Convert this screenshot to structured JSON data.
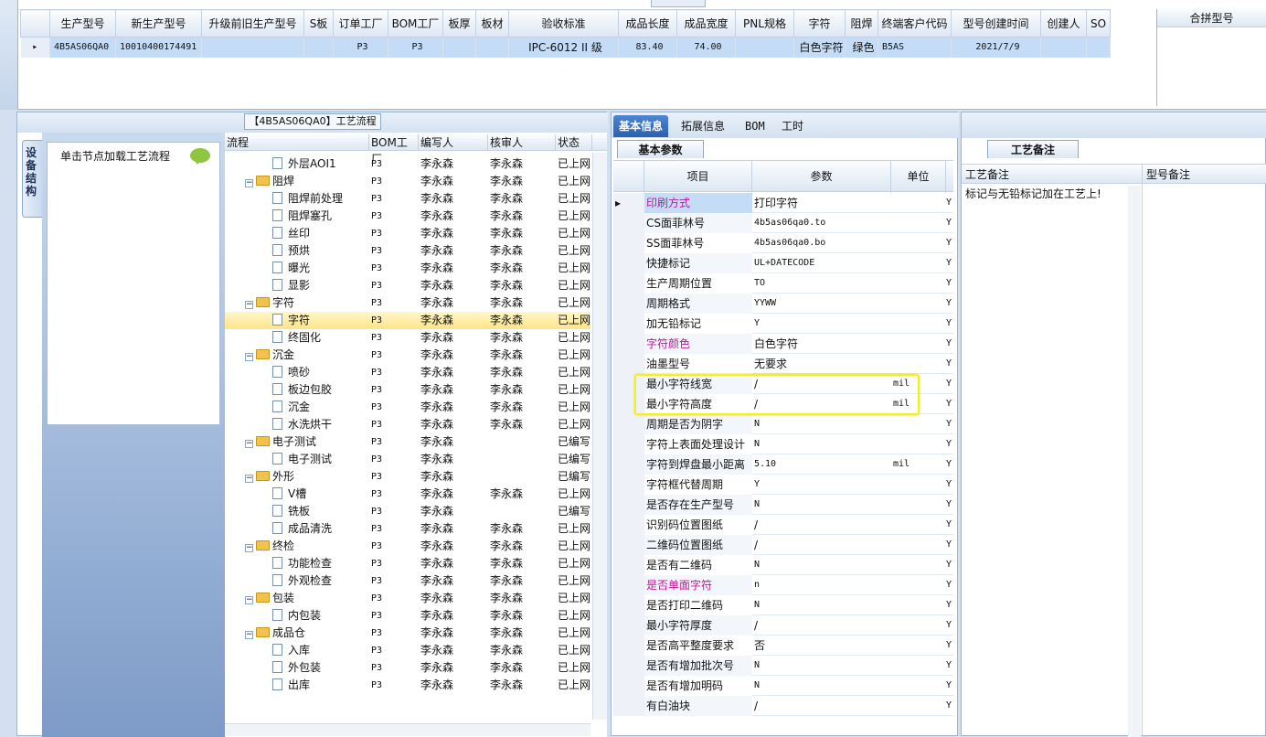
{
  "top_grid": {
    "headers": [
      "生产型号",
      "新生产型号",
      "升级前旧生产型号",
      "S板",
      "订单工厂",
      "BOM工厂",
      "板厚",
      "板材",
      "验收标准",
      "成品长度",
      "成品宽度",
      "PNL规格",
      "字符",
      "阻焊",
      "终端客户代码",
      "型号创建时间",
      "创建人",
      "SO"
    ],
    "row": [
      "4B5AS06QA0",
      "10010400174491",
      "",
      "",
      "P3",
      "P3",
      "",
      "",
      "IPC-6012 II 级",
      "83.40",
      "74.00",
      "",
      "白色字符",
      "绿色",
      "B5AS",
      "2021/7/9",
      "",
      ""
    ],
    "merge_header": "合拼型号"
  },
  "left": {
    "title": "【4B5AS06QA0】工艺流程",
    "vertical_tab": "设备结构",
    "node_hint": "单击节点加载工艺流程",
    "tree_headers": [
      "流程",
      "BOM工厂",
      "编写人",
      "核审人",
      "状态"
    ],
    "tree_rows": [
      {
        "name": "外层AOI1",
        "level": 2,
        "bom": "P3",
        "writer": "李永森",
        "reviewer": "李永森",
        "status": "已上网"
      },
      {
        "name": "阻焊",
        "level": 1,
        "bom": "P3",
        "writer": "李永森",
        "reviewer": "李永森",
        "status": "已上网"
      },
      {
        "name": "阻焊前处理",
        "level": 2,
        "bom": "P3",
        "writer": "李永森",
        "reviewer": "李永森",
        "status": "已上网"
      },
      {
        "name": "阻焊塞孔",
        "level": 2,
        "bom": "P3",
        "writer": "李永森",
        "reviewer": "李永森",
        "status": "已上网"
      },
      {
        "name": "丝印",
        "level": 2,
        "bom": "P3",
        "writer": "李永森",
        "reviewer": "李永森",
        "status": "已上网"
      },
      {
        "name": "预烘",
        "level": 2,
        "bom": "P3",
        "writer": "李永森",
        "reviewer": "李永森",
        "status": "已上网"
      },
      {
        "name": "曝光",
        "level": 2,
        "bom": "P3",
        "writer": "李永森",
        "reviewer": "李永森",
        "status": "已上网"
      },
      {
        "name": "显影",
        "level": 2,
        "bom": "P3",
        "writer": "李永森",
        "reviewer": "李永森",
        "status": "已上网"
      },
      {
        "name": "字符",
        "level": 1,
        "bom": "P3",
        "writer": "李永森",
        "reviewer": "李永森",
        "status": "已上网"
      },
      {
        "name": "字符",
        "level": 2,
        "bom": "P3",
        "writer": "李永森",
        "reviewer": "李永森",
        "status": "已上网",
        "selected": true
      },
      {
        "name": "终固化",
        "level": 2,
        "bom": "P3",
        "writer": "李永森",
        "reviewer": "李永森",
        "status": "已上网"
      },
      {
        "name": "沉金",
        "level": 1,
        "bom": "P3",
        "writer": "李永森",
        "reviewer": "李永森",
        "status": "已上网"
      },
      {
        "name": "喷砂",
        "level": 2,
        "bom": "P3",
        "writer": "李永森",
        "reviewer": "李永森",
        "status": "已上网"
      },
      {
        "name": "板边包胶",
        "level": 2,
        "bom": "P3",
        "writer": "李永森",
        "reviewer": "李永森",
        "status": "已上网"
      },
      {
        "name": "沉金",
        "level": 2,
        "bom": "P3",
        "writer": "李永森",
        "reviewer": "李永森",
        "status": "已上网"
      },
      {
        "name": "水洗烘干",
        "level": 2,
        "bom": "P3",
        "writer": "李永森",
        "reviewer": "李永森",
        "status": "已上网"
      },
      {
        "name": "电子测试",
        "level": 1,
        "bom": "P3",
        "writer": "李永森",
        "reviewer": "",
        "status": "已编写"
      },
      {
        "name": "电子测试",
        "level": 2,
        "bom": "P3",
        "writer": "李永森",
        "reviewer": "",
        "status": "已编写"
      },
      {
        "name": "外形",
        "level": 1,
        "bom": "P3",
        "writer": "李永森",
        "reviewer": "",
        "status": "已编写"
      },
      {
        "name": "V槽",
        "level": 2,
        "bom": "P3",
        "writer": "李永森",
        "reviewer": "李永森",
        "status": "已上网"
      },
      {
        "name": "铣板",
        "level": 2,
        "bom": "P3",
        "writer": "李永森",
        "reviewer": "",
        "status": "已编写"
      },
      {
        "name": "成品清洗",
        "level": 2,
        "bom": "P3",
        "writer": "李永森",
        "reviewer": "李永森",
        "status": "已上网"
      },
      {
        "name": "终检",
        "level": 1,
        "bom": "P3",
        "writer": "李永森",
        "reviewer": "李永森",
        "status": "已上网"
      },
      {
        "name": "功能检查",
        "level": 2,
        "bom": "P3",
        "writer": "李永森",
        "reviewer": "李永森",
        "status": "已上网"
      },
      {
        "name": "外观检查",
        "level": 2,
        "bom": "P3",
        "writer": "李永森",
        "reviewer": "李永森",
        "status": "已上网"
      },
      {
        "name": "包装",
        "level": 1,
        "bom": "P3",
        "writer": "李永森",
        "reviewer": "李永森",
        "status": "已上网"
      },
      {
        "name": "内包装",
        "level": 2,
        "bom": "P3",
        "writer": "李永森",
        "reviewer": "李永森",
        "status": "已上网"
      },
      {
        "name": "成品仓",
        "level": 1,
        "bom": "P3",
        "writer": "李永森",
        "reviewer": "李永森",
        "status": "已上网"
      },
      {
        "name": "入库",
        "level": 2,
        "bom": "P3",
        "writer": "李永森",
        "reviewer": "李永森",
        "status": "已上网"
      },
      {
        "name": "外包装",
        "level": 2,
        "bom": "P3",
        "writer": "李永森",
        "reviewer": "李永森",
        "status": "已上网"
      },
      {
        "name": "出库",
        "level": 2,
        "bom": "P3",
        "writer": "李永森",
        "reviewer": "李永森",
        "status": "已上网"
      }
    ]
  },
  "middle": {
    "tabs": [
      "基本信息",
      "拓展信息",
      "BOM",
      "工时"
    ],
    "sub_tab": "基本参数",
    "headers": [
      "项目",
      "参数",
      "单位"
    ],
    "rows": [
      {
        "item": "印刷方式",
        "param": "打印字符",
        "unit": "",
        "flag": "Y",
        "magenta": true,
        "current": true
      },
      {
        "item": "CS面菲林号",
        "param": "4b5as06qa0.to",
        "unit": "",
        "flag": "Y",
        "mono": true
      },
      {
        "item": "SS面菲林号",
        "param": "4b5as06qa0.bo",
        "unit": "",
        "flag": "Y",
        "mono": true
      },
      {
        "item": "快捷标记",
        "param": "UL+DATECODE",
        "unit": "",
        "flag": "Y",
        "mono": true
      },
      {
        "item": "生产周期位置",
        "param": "TO",
        "unit": "",
        "flag": "Y",
        "mono": true
      },
      {
        "item": "周期格式",
        "param": "YYWW",
        "unit": "",
        "flag": "Y",
        "mono": true
      },
      {
        "item": "加无铅标记",
        "param": "Y",
        "unit": "",
        "flag": "Y",
        "mono": true
      },
      {
        "item": "字符颜色",
        "param": "白色字符",
        "unit": "",
        "flag": "Y",
        "magenta": true
      },
      {
        "item": "油墨型号",
        "param": "无要求",
        "unit": "",
        "flag": "Y"
      },
      {
        "item": "最小字符线宽",
        "param": "/",
        "unit": "mil",
        "flag": "Y"
      },
      {
        "item": "最小字符高度",
        "param": "/",
        "unit": "mil",
        "flag": "Y"
      },
      {
        "item": "周期是否为阴字",
        "param": "N",
        "unit": "",
        "flag": "Y",
        "mono": true
      },
      {
        "item": "字符上表面处理设计",
        "param": "N",
        "unit": "",
        "flag": "Y",
        "mono": true
      },
      {
        "item": "字符到焊盘最小距离",
        "param": "5.10",
        "unit": "mil",
        "flag": "Y",
        "mono": true
      },
      {
        "item": "字符框代替周期",
        "param": "Y",
        "unit": "",
        "flag": "Y",
        "mono": true
      },
      {
        "item": "是否存在生产型号",
        "param": "N",
        "unit": "",
        "flag": "Y",
        "mono": true
      },
      {
        "item": "识别码位置图纸",
        "param": "/",
        "unit": "",
        "flag": "Y"
      },
      {
        "item": "二维码位置图纸",
        "param": "/",
        "unit": "",
        "flag": "Y"
      },
      {
        "item": "是否有二维码",
        "param": "N",
        "unit": "",
        "flag": "Y",
        "mono": true
      },
      {
        "item": "是否单面字符",
        "param": "n",
        "unit": "",
        "flag": "Y",
        "magenta": true,
        "mono": true
      },
      {
        "item": "是否打印二维码",
        "param": "N",
        "unit": "",
        "flag": "Y",
        "mono": true
      },
      {
        "item": "最小字符厚度",
        "param": "/",
        "unit": "",
        "flag": "Y"
      },
      {
        "item": "是否高平整度要求",
        "param": "否",
        "unit": "",
        "flag": "Y"
      },
      {
        "item": "是否有增加批次号",
        "param": "N",
        "unit": "",
        "flag": "Y",
        "mono": true
      },
      {
        "item": "是否有增加明码",
        "param": "N",
        "unit": "",
        "flag": "Y",
        "mono": true
      },
      {
        "item": "有白油块",
        "param": "/",
        "unit": "",
        "flag": "Y"
      }
    ]
  },
  "right": {
    "tab": "工艺备注",
    "col1": "工艺备注",
    "col2": "型号备注",
    "note": "标记与无铅标记加在工艺上!"
  },
  "colors": {
    "selection": "#c5dcf6",
    "accent": "#2a5fae",
    "magenta": "#c0169a",
    "highlight": "#f2f024"
  }
}
